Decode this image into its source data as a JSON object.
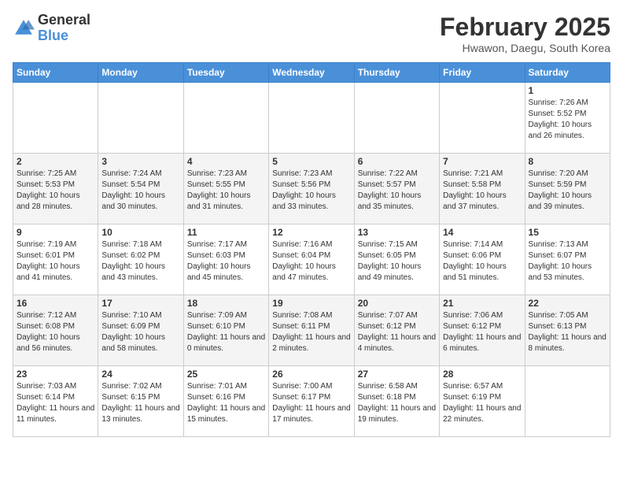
{
  "header": {
    "logo_general": "General",
    "logo_blue": "Blue",
    "month_title": "February 2025",
    "location": "Hwawon, Daegu, South Korea"
  },
  "days_of_week": [
    "Sunday",
    "Monday",
    "Tuesday",
    "Wednesday",
    "Thursday",
    "Friday",
    "Saturday"
  ],
  "weeks": [
    [
      {
        "day": "",
        "info": ""
      },
      {
        "day": "",
        "info": ""
      },
      {
        "day": "",
        "info": ""
      },
      {
        "day": "",
        "info": ""
      },
      {
        "day": "",
        "info": ""
      },
      {
        "day": "",
        "info": ""
      },
      {
        "day": "1",
        "info": "Sunrise: 7:26 AM\nSunset: 5:52 PM\nDaylight: 10 hours and 26 minutes."
      }
    ],
    [
      {
        "day": "2",
        "info": "Sunrise: 7:25 AM\nSunset: 5:53 PM\nDaylight: 10 hours and 28 minutes."
      },
      {
        "day": "3",
        "info": "Sunrise: 7:24 AM\nSunset: 5:54 PM\nDaylight: 10 hours and 30 minutes."
      },
      {
        "day": "4",
        "info": "Sunrise: 7:23 AM\nSunset: 5:55 PM\nDaylight: 10 hours and 31 minutes."
      },
      {
        "day": "5",
        "info": "Sunrise: 7:23 AM\nSunset: 5:56 PM\nDaylight: 10 hours and 33 minutes."
      },
      {
        "day": "6",
        "info": "Sunrise: 7:22 AM\nSunset: 5:57 PM\nDaylight: 10 hours and 35 minutes."
      },
      {
        "day": "7",
        "info": "Sunrise: 7:21 AM\nSunset: 5:58 PM\nDaylight: 10 hours and 37 minutes."
      },
      {
        "day": "8",
        "info": "Sunrise: 7:20 AM\nSunset: 5:59 PM\nDaylight: 10 hours and 39 minutes."
      }
    ],
    [
      {
        "day": "9",
        "info": "Sunrise: 7:19 AM\nSunset: 6:01 PM\nDaylight: 10 hours and 41 minutes."
      },
      {
        "day": "10",
        "info": "Sunrise: 7:18 AM\nSunset: 6:02 PM\nDaylight: 10 hours and 43 minutes."
      },
      {
        "day": "11",
        "info": "Sunrise: 7:17 AM\nSunset: 6:03 PM\nDaylight: 10 hours and 45 minutes."
      },
      {
        "day": "12",
        "info": "Sunrise: 7:16 AM\nSunset: 6:04 PM\nDaylight: 10 hours and 47 minutes."
      },
      {
        "day": "13",
        "info": "Sunrise: 7:15 AM\nSunset: 6:05 PM\nDaylight: 10 hours and 49 minutes."
      },
      {
        "day": "14",
        "info": "Sunrise: 7:14 AM\nSunset: 6:06 PM\nDaylight: 10 hours and 51 minutes."
      },
      {
        "day": "15",
        "info": "Sunrise: 7:13 AM\nSunset: 6:07 PM\nDaylight: 10 hours and 53 minutes."
      }
    ],
    [
      {
        "day": "16",
        "info": "Sunrise: 7:12 AM\nSunset: 6:08 PM\nDaylight: 10 hours and 56 minutes."
      },
      {
        "day": "17",
        "info": "Sunrise: 7:10 AM\nSunset: 6:09 PM\nDaylight: 10 hours and 58 minutes."
      },
      {
        "day": "18",
        "info": "Sunrise: 7:09 AM\nSunset: 6:10 PM\nDaylight: 11 hours and 0 minutes."
      },
      {
        "day": "19",
        "info": "Sunrise: 7:08 AM\nSunset: 6:11 PM\nDaylight: 11 hours and 2 minutes."
      },
      {
        "day": "20",
        "info": "Sunrise: 7:07 AM\nSunset: 6:12 PM\nDaylight: 11 hours and 4 minutes."
      },
      {
        "day": "21",
        "info": "Sunrise: 7:06 AM\nSunset: 6:12 PM\nDaylight: 11 hours and 6 minutes."
      },
      {
        "day": "22",
        "info": "Sunrise: 7:05 AM\nSunset: 6:13 PM\nDaylight: 11 hours and 8 minutes."
      }
    ],
    [
      {
        "day": "23",
        "info": "Sunrise: 7:03 AM\nSunset: 6:14 PM\nDaylight: 11 hours and 11 minutes."
      },
      {
        "day": "24",
        "info": "Sunrise: 7:02 AM\nSunset: 6:15 PM\nDaylight: 11 hours and 13 minutes."
      },
      {
        "day": "25",
        "info": "Sunrise: 7:01 AM\nSunset: 6:16 PM\nDaylight: 11 hours and 15 minutes."
      },
      {
        "day": "26",
        "info": "Sunrise: 7:00 AM\nSunset: 6:17 PM\nDaylight: 11 hours and 17 minutes."
      },
      {
        "day": "27",
        "info": "Sunrise: 6:58 AM\nSunset: 6:18 PM\nDaylight: 11 hours and 19 minutes."
      },
      {
        "day": "28",
        "info": "Sunrise: 6:57 AM\nSunset: 6:19 PM\nDaylight: 11 hours and 22 minutes."
      },
      {
        "day": "",
        "info": ""
      }
    ]
  ]
}
